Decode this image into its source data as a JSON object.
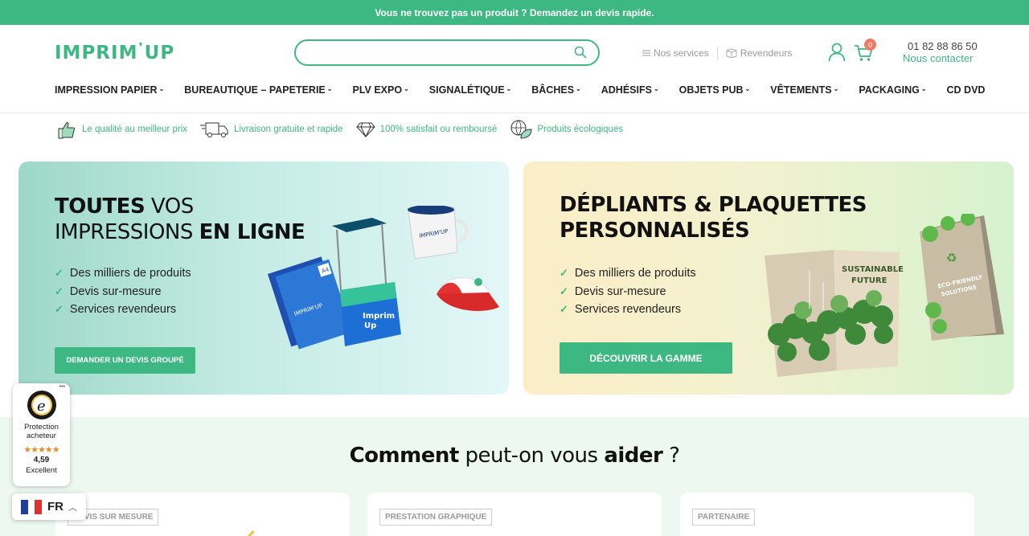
{
  "topbar": {
    "question": "Vous ne trouvez pas un produit ?",
    "cta": "Demandez un devis rapide."
  },
  "header": {
    "logo_left": "IMPRIM",
    "logo_right": "UP",
    "search_placeholder": "",
    "links": [
      "Nos services",
      "Revendeurs"
    ],
    "cart_count": "0",
    "phone": "01 82 88 86 50",
    "contact": "Nous contacter"
  },
  "nav": [
    "IMPRESSION PAPIER",
    "BUREAUTIQUE – PAPETERIE",
    "PLV EXPO",
    "SIGNALÉTIQUE",
    "BÂCHES",
    "ADHÉSIFS",
    "OBJETS PUB",
    "VÊTEMENTS",
    "PACKAGING",
    "CD DVD"
  ],
  "features": [
    "Le qualité au meilleur prix",
    "Livraison gratuite et rapide",
    "100% satisfait ou remboursé",
    "Produits écologiques"
  ],
  "banner_left": {
    "title_a": "TOUTES",
    "title_b": " VOS",
    "title_c": "IMPRESSIONS ",
    "title_d": "EN LIGNE",
    "checks": [
      "Des milliers de produits",
      "Devis sur-mesure",
      "Services revendeurs"
    ],
    "button": "DEMANDER UN DEVIS GROUPÉ",
    "a4_label": "A4",
    "booklet_brand": "IMPRIM'UP",
    "mug_brand": "IMPRIM'UP",
    "stand_text_1": "Imprim",
    "stand_text_2": "Up"
  },
  "banner_right": {
    "title_line1": "DÉPLIANTS & PLAQUETTES",
    "title_line2": "PERSONNALISÉS",
    "checks": [
      "Des milliers de produits",
      "Devis sur-mesure",
      "Services revendeurs"
    ],
    "button": "DÉCOUVRIR LA GAMME",
    "brochure_text_1": "SUSTAINABLE",
    "brochure_text_2": "FUTURE",
    "eco_text_1": "ECO-FRIENDLY",
    "eco_text_2": "SOLUTIONS"
  },
  "help": {
    "a": "Comment",
    "b": " peut-on vous ",
    "c": "aider",
    "d": " ?"
  },
  "cards": [
    "DEVIS SUR MESURE",
    "PRESTATION GRAPHIQUE",
    "PARTENAIRE"
  ],
  "trusted": {
    "label_1": "Protection",
    "label_2": "acheteur",
    "stars": "★★★★★",
    "score": "4,59",
    "rating": "Excellent",
    "more": "•••"
  },
  "lang": {
    "code": "FR"
  },
  "colors": {
    "brand": "#3db882",
    "badge": "#f07b63"
  }
}
